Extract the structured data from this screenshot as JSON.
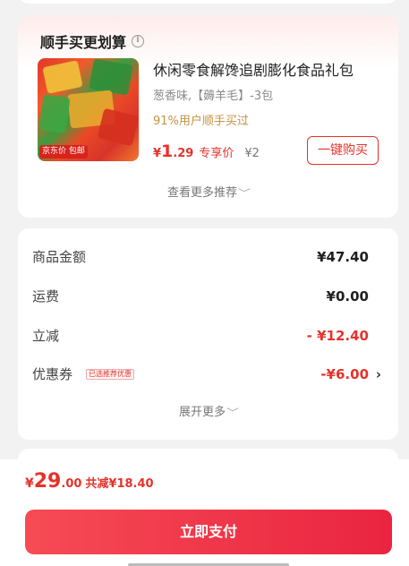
{
  "recommend": {
    "title": "顺手买更划算",
    "info_icon": "info-icon",
    "product": {
      "thumb_tag": "京东价 包邮",
      "title": "休闲零食解馋追剧膨化食品礼包",
      "spec": "葱香味,【薅羊毛】-3包",
      "social_proof": "91%用户顺手买过",
      "price_currency": "¥",
      "price_int": "1",
      "price_dec": ".29",
      "price_tag": "专享价",
      "original_price": "¥2",
      "buy_label": "一键购买"
    },
    "more_label": "查看更多推荐"
  },
  "summary": {
    "rows": [
      {
        "label": "商品金额",
        "value": "¥47.40"
      },
      {
        "label": "运费",
        "value": "¥0.00"
      },
      {
        "label": "立减",
        "value": "- ¥12.40"
      },
      {
        "label": "优惠券",
        "value": "-¥6.00",
        "badge": "已选推荐优惠"
      }
    ],
    "expand_label": "展开更多"
  },
  "footer": {
    "currency": "¥",
    "total_int": "29",
    "total_dec": ".00",
    "saved": "共减¥18.40",
    "pay_label": "立即支付"
  },
  "colors": {
    "accent": "#e6322b",
    "pay_gradient_start": "#f64b55",
    "pay_gradient_end": "#ea2440",
    "social_proof": "#c59043"
  }
}
